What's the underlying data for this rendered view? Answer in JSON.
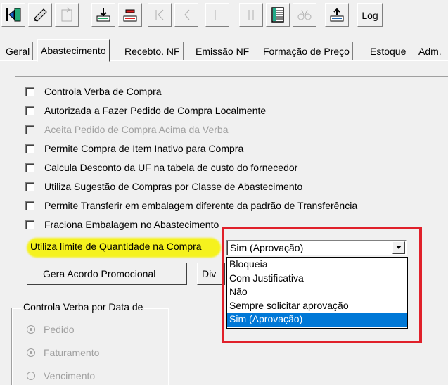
{
  "toolbar": {
    "log_label": "Log",
    "icons": [
      "exit-icon",
      "edit-icon",
      "new-icon",
      "save-icon",
      "delete-icon",
      "first-icon",
      "prev-icon",
      "next-icon",
      "last-icon",
      "grid-icon",
      "binoculars-icon",
      "print-icon"
    ]
  },
  "tabs": [
    "Geral",
    "Abastecimento",
    "Recebto. NF",
    "Emissão NF",
    "Formação de Preço",
    "Estoque",
    "Adm."
  ],
  "options": [
    {
      "label": "Controla Verba de Compra",
      "checked": false,
      "enabled": true
    },
    {
      "label": "Autorizada a Fazer Pedido de Compra Localmente",
      "checked": false,
      "enabled": true
    },
    {
      "label": "Aceita Pedido de Compra Acima da Verba",
      "checked": false,
      "enabled": false
    },
    {
      "label": "Permite Compra de Item Inativo para Compra",
      "checked": false,
      "enabled": true
    },
    {
      "label": "Calcula Desconto da UF na tabela de custo do fornecedor",
      "checked": false,
      "enabled": true
    },
    {
      "label": "Utiliza Sugestão de Compras por Classe de Abastecimento",
      "checked": false,
      "enabled": true
    },
    {
      "label": "Permite Transferir em embalagem diferente da padrão de Transferência",
      "checked": false,
      "enabled": true
    },
    {
      "label": "Fraciona Embalagem no Abastecimento",
      "checked": false,
      "enabled": true
    }
  ],
  "limit_label": "Utiliza limite de Quantidade na Compra",
  "limit_select": {
    "value": "Sim (Aprovação)",
    "options": [
      "Bloqueia",
      "Com Justificativa",
      "Não",
      "Sempre solicitar aprovação",
      "Sim (Aprovação)"
    ],
    "selected_index": 4
  },
  "buttons": {
    "acordo": "Gera Acordo Promocional",
    "div": "Div"
  },
  "verba_group": {
    "title": "Controla Verba por Data de",
    "options": [
      {
        "label": "Pedido",
        "checked": true
      },
      {
        "label": "Faturamento",
        "checked": true
      },
      {
        "label": "Vencimento",
        "checked": false
      }
    ]
  },
  "colors": {
    "highlight": "#f5f21e",
    "annotation_frame": "#e0202a",
    "selection": "#0078d7"
  }
}
